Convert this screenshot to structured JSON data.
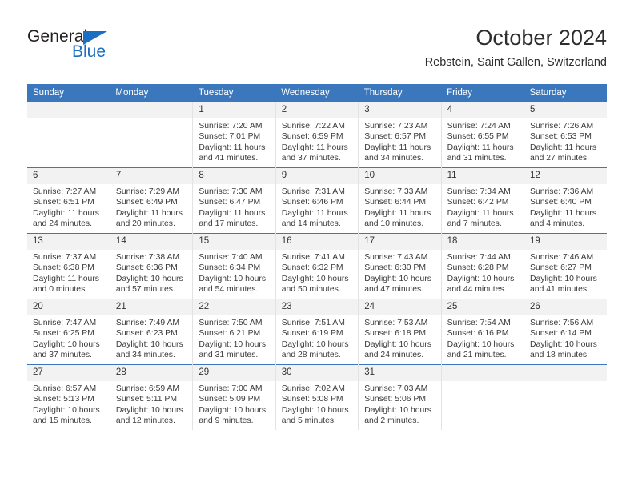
{
  "brand": {
    "name_part1": "General",
    "name_part2": "Blue",
    "accent_color": "#1b6ec2"
  },
  "header": {
    "month_title": "October 2024",
    "location": "Rebstein, Saint Gallen, Switzerland"
  },
  "calendar": {
    "header_bg_color": "#3b77bd",
    "weekday_headers": [
      "Sunday",
      "Monday",
      "Tuesday",
      "Wednesday",
      "Thursday",
      "Friday",
      "Saturday"
    ],
    "weeks": [
      [
        {
          "day": "",
          "empty": true
        },
        {
          "day": "",
          "empty": true
        },
        {
          "day": "1",
          "sunrise": "Sunrise: 7:20 AM",
          "sunset": "Sunset: 7:01 PM",
          "daylight": "Daylight: 11 hours and 41 minutes."
        },
        {
          "day": "2",
          "sunrise": "Sunrise: 7:22 AM",
          "sunset": "Sunset: 6:59 PM",
          "daylight": "Daylight: 11 hours and 37 minutes."
        },
        {
          "day": "3",
          "sunrise": "Sunrise: 7:23 AM",
          "sunset": "Sunset: 6:57 PM",
          "daylight": "Daylight: 11 hours and 34 minutes."
        },
        {
          "day": "4",
          "sunrise": "Sunrise: 7:24 AM",
          "sunset": "Sunset: 6:55 PM",
          "daylight": "Daylight: 11 hours and 31 minutes."
        },
        {
          "day": "5",
          "sunrise": "Sunrise: 7:26 AM",
          "sunset": "Sunset: 6:53 PM",
          "daylight": "Daylight: 11 hours and 27 minutes."
        }
      ],
      [
        {
          "day": "6",
          "sunrise": "Sunrise: 7:27 AM",
          "sunset": "Sunset: 6:51 PM",
          "daylight": "Daylight: 11 hours and 24 minutes."
        },
        {
          "day": "7",
          "sunrise": "Sunrise: 7:29 AM",
          "sunset": "Sunset: 6:49 PM",
          "daylight": "Daylight: 11 hours and 20 minutes."
        },
        {
          "day": "8",
          "sunrise": "Sunrise: 7:30 AM",
          "sunset": "Sunset: 6:47 PM",
          "daylight": "Daylight: 11 hours and 17 minutes."
        },
        {
          "day": "9",
          "sunrise": "Sunrise: 7:31 AM",
          "sunset": "Sunset: 6:46 PM",
          "daylight": "Daylight: 11 hours and 14 minutes."
        },
        {
          "day": "10",
          "sunrise": "Sunrise: 7:33 AM",
          "sunset": "Sunset: 6:44 PM",
          "daylight": "Daylight: 11 hours and 10 minutes."
        },
        {
          "day": "11",
          "sunrise": "Sunrise: 7:34 AM",
          "sunset": "Sunset: 6:42 PM",
          "daylight": "Daylight: 11 hours and 7 minutes."
        },
        {
          "day": "12",
          "sunrise": "Sunrise: 7:36 AM",
          "sunset": "Sunset: 6:40 PM",
          "daylight": "Daylight: 11 hours and 4 minutes."
        }
      ],
      [
        {
          "day": "13",
          "sunrise": "Sunrise: 7:37 AM",
          "sunset": "Sunset: 6:38 PM",
          "daylight": "Daylight: 11 hours and 0 minutes."
        },
        {
          "day": "14",
          "sunrise": "Sunrise: 7:38 AM",
          "sunset": "Sunset: 6:36 PM",
          "daylight": "Daylight: 10 hours and 57 minutes."
        },
        {
          "day": "15",
          "sunrise": "Sunrise: 7:40 AM",
          "sunset": "Sunset: 6:34 PM",
          "daylight": "Daylight: 10 hours and 54 minutes."
        },
        {
          "day": "16",
          "sunrise": "Sunrise: 7:41 AM",
          "sunset": "Sunset: 6:32 PM",
          "daylight": "Daylight: 10 hours and 50 minutes."
        },
        {
          "day": "17",
          "sunrise": "Sunrise: 7:43 AM",
          "sunset": "Sunset: 6:30 PM",
          "daylight": "Daylight: 10 hours and 47 minutes."
        },
        {
          "day": "18",
          "sunrise": "Sunrise: 7:44 AM",
          "sunset": "Sunset: 6:28 PM",
          "daylight": "Daylight: 10 hours and 44 minutes."
        },
        {
          "day": "19",
          "sunrise": "Sunrise: 7:46 AM",
          "sunset": "Sunset: 6:27 PM",
          "daylight": "Daylight: 10 hours and 41 minutes."
        }
      ],
      [
        {
          "day": "20",
          "sunrise": "Sunrise: 7:47 AM",
          "sunset": "Sunset: 6:25 PM",
          "daylight": "Daylight: 10 hours and 37 minutes."
        },
        {
          "day": "21",
          "sunrise": "Sunrise: 7:49 AM",
          "sunset": "Sunset: 6:23 PM",
          "daylight": "Daylight: 10 hours and 34 minutes."
        },
        {
          "day": "22",
          "sunrise": "Sunrise: 7:50 AM",
          "sunset": "Sunset: 6:21 PM",
          "daylight": "Daylight: 10 hours and 31 minutes."
        },
        {
          "day": "23",
          "sunrise": "Sunrise: 7:51 AM",
          "sunset": "Sunset: 6:19 PM",
          "daylight": "Daylight: 10 hours and 28 minutes."
        },
        {
          "day": "24",
          "sunrise": "Sunrise: 7:53 AM",
          "sunset": "Sunset: 6:18 PM",
          "daylight": "Daylight: 10 hours and 24 minutes."
        },
        {
          "day": "25",
          "sunrise": "Sunrise: 7:54 AM",
          "sunset": "Sunset: 6:16 PM",
          "daylight": "Daylight: 10 hours and 21 minutes."
        },
        {
          "day": "26",
          "sunrise": "Sunrise: 7:56 AM",
          "sunset": "Sunset: 6:14 PM",
          "daylight": "Daylight: 10 hours and 18 minutes."
        }
      ],
      [
        {
          "day": "27",
          "sunrise": "Sunrise: 6:57 AM",
          "sunset": "Sunset: 5:13 PM",
          "daylight": "Daylight: 10 hours and 15 minutes."
        },
        {
          "day": "28",
          "sunrise": "Sunrise: 6:59 AM",
          "sunset": "Sunset: 5:11 PM",
          "daylight": "Daylight: 10 hours and 12 minutes."
        },
        {
          "day": "29",
          "sunrise": "Sunrise: 7:00 AM",
          "sunset": "Sunset: 5:09 PM",
          "daylight": "Daylight: 10 hours and 9 minutes."
        },
        {
          "day": "30",
          "sunrise": "Sunrise: 7:02 AM",
          "sunset": "Sunset: 5:08 PM",
          "daylight": "Daylight: 10 hours and 5 minutes."
        },
        {
          "day": "31",
          "sunrise": "Sunrise: 7:03 AM",
          "sunset": "Sunset: 5:06 PM",
          "daylight": "Daylight: 10 hours and 2 minutes."
        },
        {
          "day": "",
          "empty": true
        },
        {
          "day": "",
          "empty": true
        }
      ]
    ]
  }
}
